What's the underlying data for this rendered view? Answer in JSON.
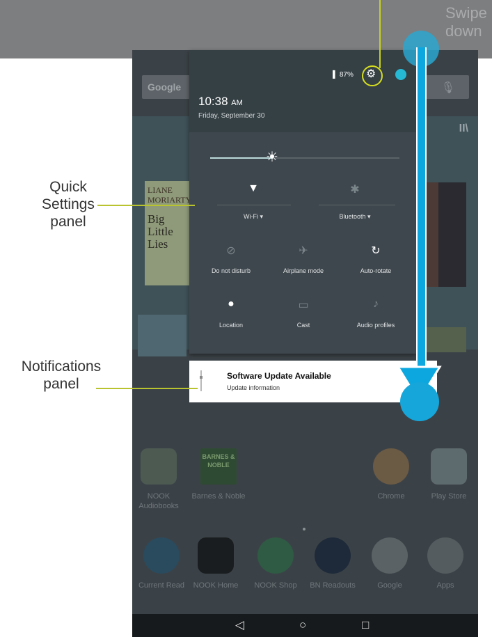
{
  "swipe_hint": "Swipe\ndown",
  "home": {
    "search_logo": "Google",
    "book_left": {
      "line1": "LIANE",
      "line2": "MORIARTY",
      "title": "Big Little Lies"
    },
    "apps_row1": [
      {
        "label": "NOOK Audiobooks"
      },
      {
        "label": "Barnes & Noble"
      },
      {
        "label": "Chrome"
      },
      {
        "label": "Play Store"
      }
    ],
    "dock": [
      {
        "label": "Current Read"
      },
      {
        "label": "NOOK Home"
      },
      {
        "label": "NOOK Shop"
      },
      {
        "label": "BN Readouts"
      },
      {
        "label": "Google"
      },
      {
        "label": "Apps"
      }
    ],
    "barnes_icon_text": "BARNES & NOBLE"
  },
  "quick_settings": {
    "battery": "87%",
    "time": "10:38",
    "time_suffix": "AM",
    "date": "Friday, September 30",
    "brightness_level": 0.33,
    "tiles": [
      {
        "label": "Wi-Fi",
        "icon": "wifi-icon"
      },
      {
        "label": "Bluetooth",
        "icon": "bluetooth-icon"
      },
      {
        "label": "Do not disturb",
        "icon": "do-not-disturb-icon"
      },
      {
        "label": "Airplane mode",
        "icon": "airplane-icon"
      },
      {
        "label": "Auto-rotate",
        "icon": "auto-rotate-icon"
      },
      {
        "label": "Location",
        "icon": "location-icon"
      },
      {
        "label": "Cast",
        "icon": "cast-icon"
      },
      {
        "label": "Audio profiles",
        "icon": "audio-profiles-icon"
      }
    ]
  },
  "notification": {
    "title": "Software Update Available",
    "text": "Update information"
  },
  "callouts": {
    "quick_settings": "Quick\nSettings\npanel",
    "notifications": "Notifications\npanel"
  },
  "colors": {
    "accent": "#c8cf1c",
    "swipe": "#0ca7df"
  }
}
